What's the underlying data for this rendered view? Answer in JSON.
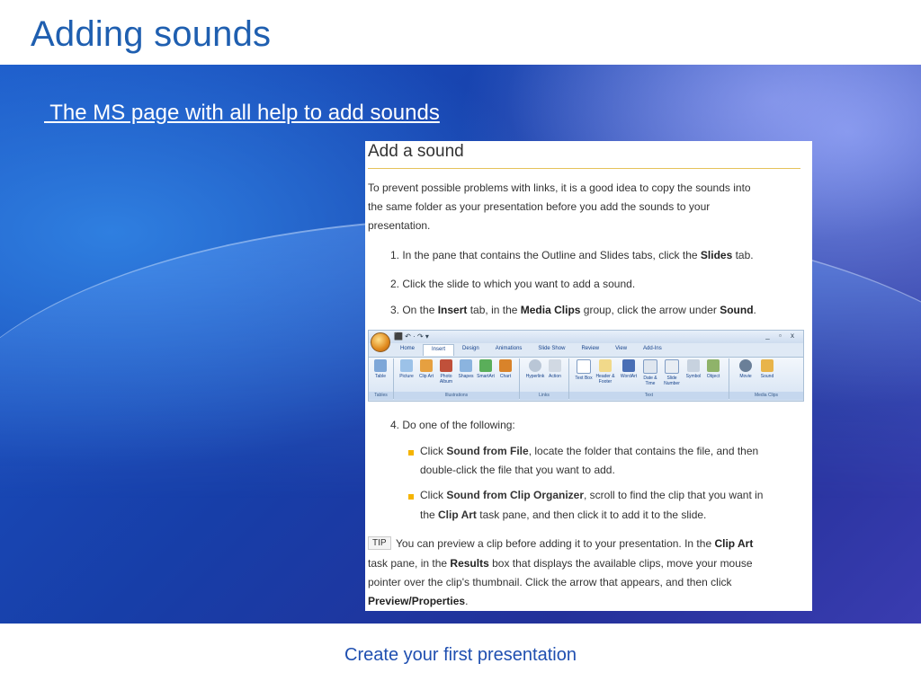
{
  "slide": {
    "title": "Adding sounds",
    "link_text": " The MS page with all help to add sounds",
    "footer": "Create your first presentation"
  },
  "help": {
    "heading": "Add a sound",
    "intro": [
      "To prevent possible problems with links, it is a good idea to copy the sounds into",
      "the same folder as your presentation before you add the sounds to your",
      "presentation."
    ],
    "step1": {
      "pre": "1.  In the pane that contains the Outline and Slides tabs, click the ",
      "bold": "Slides",
      "post": " tab."
    },
    "step2": "2.  Click the slide to which you want to add a sound.",
    "step3": {
      "pre": "3.  On the ",
      "b1": "Insert",
      "mid": " tab, in the ",
      "b2": "Media Clips",
      "mid2": " group, click the arrow under ",
      "b3": "Sound",
      "post": "."
    },
    "step4": "4.  Do one of the following:",
    "bullet1": {
      "pre": "Click ",
      "bold": "Sound from File",
      "post": ", locate the folder that contains the file, and then",
      "line2": "double-click the file that you want to add."
    },
    "bullet2": {
      "pre": "Click ",
      "bold": "Sound from Clip Organizer",
      "post": ", scroll to find the clip that you want in",
      "line2_pre": "the ",
      "line2_bold": "Clip Art",
      "line2_post": " task pane, and then click it to add it to the slide."
    },
    "tip_label": "TIP",
    "tip": {
      "l1_pre": "You can preview a clip before adding it to your presentation. In the ",
      "l1_bold": "Clip Art",
      "l2_pre": "task pane, in the ",
      "l2_bold": "Results",
      "l2_post": " box that displays the available clips, move your mouse",
      "l3": "pointer over the clip's thumbnail. Click the arrow that appears, and then click",
      "l4_bold": "Preview/Properties",
      "l4_post": "."
    }
  },
  "ribbon": {
    "tabs": [
      "Home",
      "Insert",
      "Design",
      "Animations",
      "Slide Show",
      "Review",
      "View",
      "Add-Ins"
    ],
    "window_controls": "_ ▫ x",
    "qat": "⬛ ↶ · ↷ ▾",
    "tools": [
      "Table",
      "Picture",
      "Clip Art",
      "Photo Album",
      "Shapes",
      "SmartArt",
      "Chart",
      "Hyperlink",
      "Action",
      "Text Box",
      "Header & Footer",
      "WordArt",
      "Date & Time",
      "Slide Number",
      "Symbol",
      "Object",
      "Movie",
      "Sound"
    ],
    "groups": [
      "Tables",
      "Illustrations",
      "Links",
      "Text",
      "Media Clips"
    ],
    "colors": {
      "accent": "#f5b400",
      "brand": "#1f5fb0"
    }
  }
}
